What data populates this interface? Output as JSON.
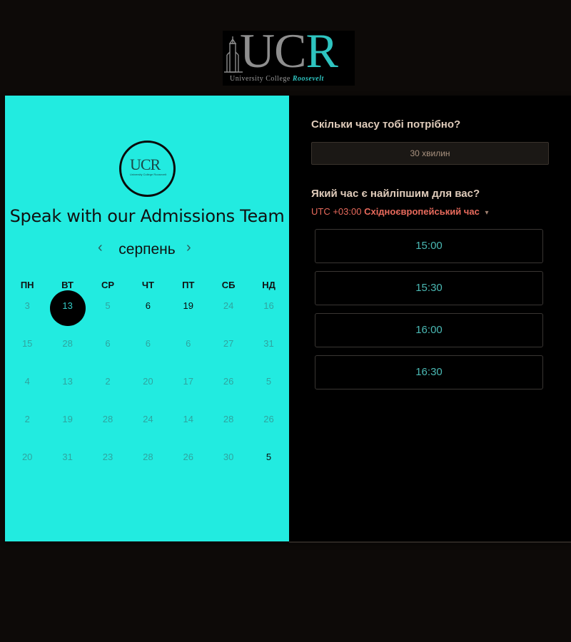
{
  "header": {
    "logo_letters": [
      "U",
      "C",
      "R"
    ],
    "logo_sub_plain": "University College",
    "logo_sub_accent": "Roosevelt"
  },
  "colors": {
    "page_bg": "#0d0a08",
    "calendar_bg": "#22ebe0",
    "accent_red": "#e86a5c",
    "slot_text": "#4ab8b3"
  },
  "event": {
    "circle_logo_text": "UCR",
    "circle_logo_sub": "University College Roosevelt",
    "title": "Speak with our Admissions Team"
  },
  "calendar": {
    "month": "серпень",
    "prev_icon": "‹",
    "next_icon": "›",
    "weekdays": [
      "ПН",
      "ВТ",
      "СР",
      "ЧТ",
      "ПТ",
      "СБ",
      "НД"
    ],
    "weeks": [
      [
        {
          "d": "3"
        },
        {
          "d": "13",
          "sel": true
        },
        {
          "d": "5"
        },
        {
          "d": "6",
          "av": true
        },
        {
          "d": "19",
          "av": true
        },
        {
          "d": "24"
        },
        {
          "d": "16"
        }
      ],
      [
        {
          "d": "15"
        },
        {
          "d": "28"
        },
        {
          "d": "6"
        },
        {
          "d": "6"
        },
        {
          "d": "6"
        },
        {
          "d": "27"
        },
        {
          "d": "31"
        }
      ],
      [
        {
          "d": "4"
        },
        {
          "d": "13"
        },
        {
          "d": "2"
        },
        {
          "d": "20"
        },
        {
          "d": "17"
        },
        {
          "d": "26"
        },
        {
          "d": "5"
        }
      ],
      [
        {
          "d": "2"
        },
        {
          "d": "19"
        },
        {
          "d": "28"
        },
        {
          "d": "24"
        },
        {
          "d": "14"
        },
        {
          "d": "28"
        },
        {
          "d": "26"
        }
      ],
      [
        {
          "d": "20"
        },
        {
          "d": "31"
        },
        {
          "d": "23"
        },
        {
          "d": "28"
        },
        {
          "d": "26"
        },
        {
          "d": "30"
        },
        {
          "d": "5",
          "av": true
        }
      ]
    ]
  },
  "right": {
    "duration_question": "Скільки часу тобі потрібно?",
    "duration_value": "30 хвилин",
    "time_question": "Який час є найліпшим для вас?",
    "tz_offset": "UTC +03:00",
    "tz_name": "Східноєвропейський час",
    "tz_caret": "▾",
    "slots": [
      "15:00",
      "15:30",
      "16:00",
      "16:30"
    ]
  }
}
